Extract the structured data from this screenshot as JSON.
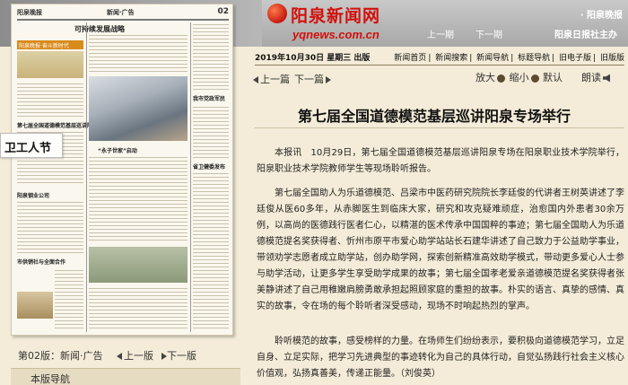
{
  "header": {
    "site_title": "阳泉新闻网",
    "site_url": "yqnews.com.cn",
    "brand_link": "· 阳泉晚报",
    "prev_label": "上一期",
    "next_label": "下一期",
    "archive_label": "阳泉日报社主办"
  },
  "paper": {
    "masthead_left": "阳泉晚报",
    "masthead_mid": "新闻·广告",
    "page_number": "02",
    "headline": "可持续发展战略",
    "banner_text": "阳泉晚报·奋斗新时代",
    "side_headlines": [
      "第七届全国道德模范基层巡讲阳泉专场举行",
      "我市党政军民",
      "“永子世家”启动",
      "省卫健委发布",
      "阳泉钢业公司",
      "市供销社与全面合作"
    ]
  },
  "float_label": "卫工人节",
  "page_bar": {
    "page_label": "第02版：新闻·广告",
    "prev_label": "上一版",
    "next_label": "下一版",
    "nav_head": "本版导航"
  },
  "article": {
    "date_line": "2019年10月30日 星期三 出版",
    "nav_links": [
      "新闻首页",
      "新闻搜索",
      "新闻导航",
      "标题导航",
      "旧电子版",
      "旧版版"
    ],
    "prev_label": "上一篇",
    "next_label": "下一篇",
    "zoom_labels": [
      "放大",
      "缩小",
      "默认"
    ],
    "read_label": "朗读",
    "title": "第七届全国道德模范基层巡讲阳泉专场举行",
    "paragraphs": [
      "本报讯　10月29日，第七届全国道德模范基层巡讲阳泉专场在阳泉职业技术学院举行，阳泉职业技术学院教师学生等现场聆听报告。",
      "第七届全国助人为乐道德模范、吕梁市中医药研究院院长李廷俊的代讲者王树英讲述了李廷俊从医60多年，从赤脚医生到临床大家，研究和攻克疑难顽症，治愈国内外患者30余万例，以高尚的医德践行医者仁心，以精湛的医术传承中国国粹的事迹；第七届全国助人为乐道德模范提名奖获得者、忻州市原平市爱心助学站站长石建华讲述了自己致力于公益助学事业，带领劝学志愿者成立助学站，创办助学网，探索创新精准高效助学模式，带动更多爱心人士参与助学活动，让更多学生享受助学成果的故事；第七届全国孝老爱亲道德模范提名奖获得者张美静讲述了自己用稚嫩肩膀勇敢承担起照顾家庭的重担的故事。朴实的语言、真挚的感情、真实的故事，令在场的每个聆听者深受感动，现场不时响起热烈的掌声。",
      "聆听模范的故事，感受榜样的力量。在场师生们纷纷表示，要积极向道德模范学习，立足自身、立足实际，把学习先进典型的事迹转化为自己的具体行动，自觉弘扬践行社会主义核心价值观，弘扬真善美，传递正能量。（刘俊英）"
    ]
  }
}
